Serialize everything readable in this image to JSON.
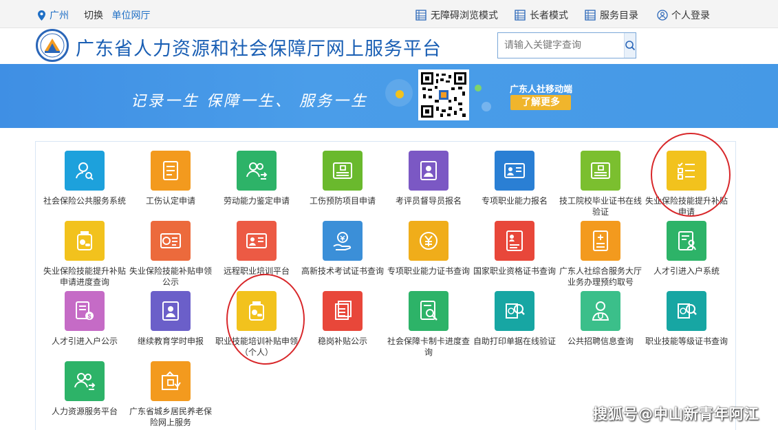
{
  "topbar": {
    "city": "广州",
    "switch_label": "切换",
    "unit_hall": "单位网厅",
    "links": [
      "无障碍浏览模式",
      "长者模式",
      "服务目录"
    ],
    "login": "个人登录"
  },
  "header": {
    "title": "广东省人力资源和社会保障厅网上服务平台",
    "search_placeholder": "请输入关键字查询"
  },
  "banner": {
    "slogan": "记录一生  保障一生、  服务一生",
    "mobile_label": "广东人社移动端",
    "more_button": "了解更多"
  },
  "tiles": [
    {
      "label": "社会保险公共服务系统",
      "color": "#1da1dc",
      "icon": "person-search-icon"
    },
    {
      "label": "工伤认定申请",
      "color": "#f39a1e",
      "icon": "document-icon"
    },
    {
      "label": "劳动能力鉴定申请",
      "color": "#2db368",
      "icon": "people-transfer-icon"
    },
    {
      "label": "工伤预防项目申请",
      "color": "#6ab92d",
      "icon": "certificate-icon"
    },
    {
      "label": "考评员督导员报名",
      "color": "#7b58c4",
      "icon": "badge-person-icon"
    },
    {
      "label": "专项职业能力报名",
      "color": "#2a7fd4",
      "icon": "id-card-icon"
    },
    {
      "label": "技工院校毕业证书在线验证",
      "color": "#7bbf2f",
      "icon": "certificate-icon"
    },
    {
      "label": "失业保险技能提升补贴申请",
      "color": "#f2c21d",
      "icon": "checklist-icon"
    },
    {
      "label": "失业保险技能提升补贴申请进度查询",
      "color": "#f2c21d",
      "icon": "medicine-bottle-icon"
    },
    {
      "label": "失业保险技能补贴申领公示",
      "color": "#ec6a3c",
      "icon": "si-card-icon"
    },
    {
      "label": "远程职业培训平台",
      "color": "#ec5a44",
      "icon": "id-card-icon"
    },
    {
      "label": "高新技术考试证书查询",
      "color": "#3b8fd8",
      "icon": "hand-coin-icon"
    },
    {
      "label": "专项职业能力证书查询",
      "color": "#f0ad1a",
      "icon": "yuan-coin-icon"
    },
    {
      "label": "国家职业资格证书查询",
      "color": "#e8473a",
      "icon": "profile-doc-icon"
    },
    {
      "label": "广东人社综合服务大厅业务办理预约取号",
      "color": "#f39a1e",
      "icon": "document-plus-icon"
    },
    {
      "label": "人才引进入户系统",
      "color": "#2db368",
      "icon": "person-doc-icon"
    },
    {
      "label": "人才引进入户公示",
      "color": "#c56bc6",
      "icon": "doc-money-icon"
    },
    {
      "label": "继续教育学时申报",
      "color": "#6b5fc9",
      "icon": "badge-person-icon"
    },
    {
      "label": "职业技能培训补贴申领（个人）",
      "color": "#f2c21d",
      "icon": "medicine-bottle-icon"
    },
    {
      "label": "稳岗补贴公示",
      "color": "#e8473a",
      "icon": "stacked-docs-icon"
    },
    {
      "label": "社会保障卡制卡进度查询",
      "color": "#2db368",
      "icon": "doc-search-icon"
    },
    {
      "label": "自助打印单据在线验证",
      "color": "#17a6a3",
      "icon": "si-search-icon"
    },
    {
      "label": "公共招聘信息查询",
      "color": "#3bbf8a",
      "icon": "doctor-icon"
    },
    {
      "label": "职业技能等级证书查询",
      "color": "#17a6a3",
      "icon": "si-search-icon"
    },
    {
      "label": "人力资源服务平台",
      "color": "#2db368",
      "icon": "people-transfer-icon"
    },
    {
      "label": "广东省城乡居民养老保险网上服务",
      "color": "#f39a1e",
      "icon": "house-doc-icon"
    }
  ],
  "watermark": "搜狐号@中山新青年阿江"
}
